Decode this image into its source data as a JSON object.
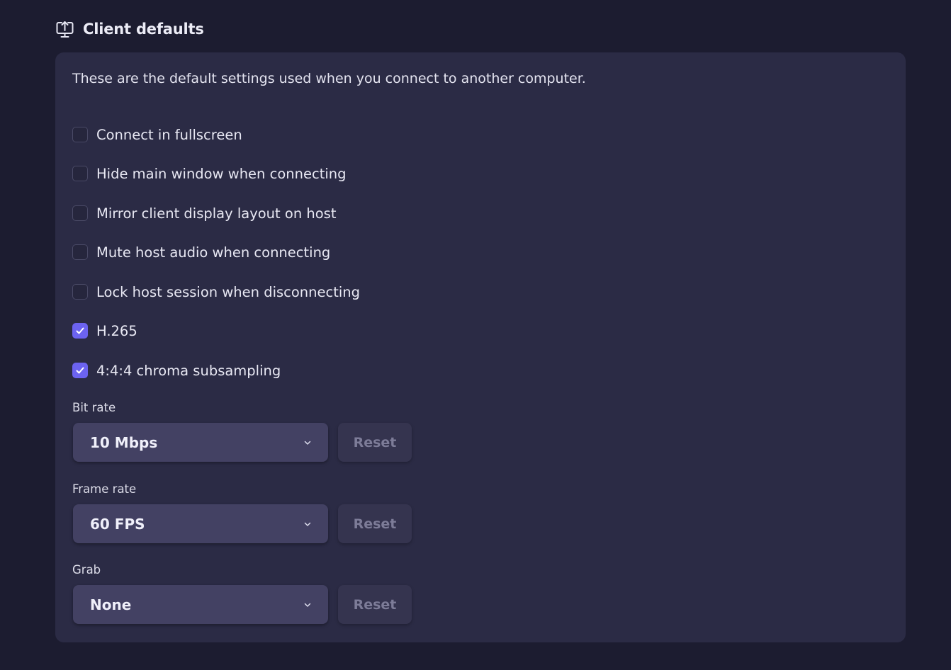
{
  "section": {
    "title": "Client defaults",
    "icon": "monitor-upload-icon"
  },
  "description": "These are the default settings used when you connect to another computer.",
  "checkboxes": [
    {
      "label": "Connect in fullscreen",
      "checked": false
    },
    {
      "label": "Hide main window when connecting",
      "checked": false
    },
    {
      "label": "Mirror client display layout on host",
      "checked": false
    },
    {
      "label": "Mute host audio when connecting",
      "checked": false
    },
    {
      "label": "Lock host session when disconnecting",
      "checked": false
    },
    {
      "label": "H.265",
      "checked": true
    },
    {
      "label": "4:4:4 chroma subsampling",
      "checked": true
    }
  ],
  "bitrate": {
    "label": "Bit rate",
    "value": "10 Mbps",
    "reset_label": "Reset"
  },
  "framerate": {
    "label": "Frame rate",
    "value": "60 FPS",
    "reset_label": "Reset"
  },
  "grab": {
    "label": "Grab",
    "value": "None",
    "reset_label": "Reset"
  },
  "colors": {
    "background": "#1c1c30",
    "card": "#2b2b45",
    "accent": "#6c63f0",
    "select": "#434163",
    "reset": "#35344f"
  }
}
